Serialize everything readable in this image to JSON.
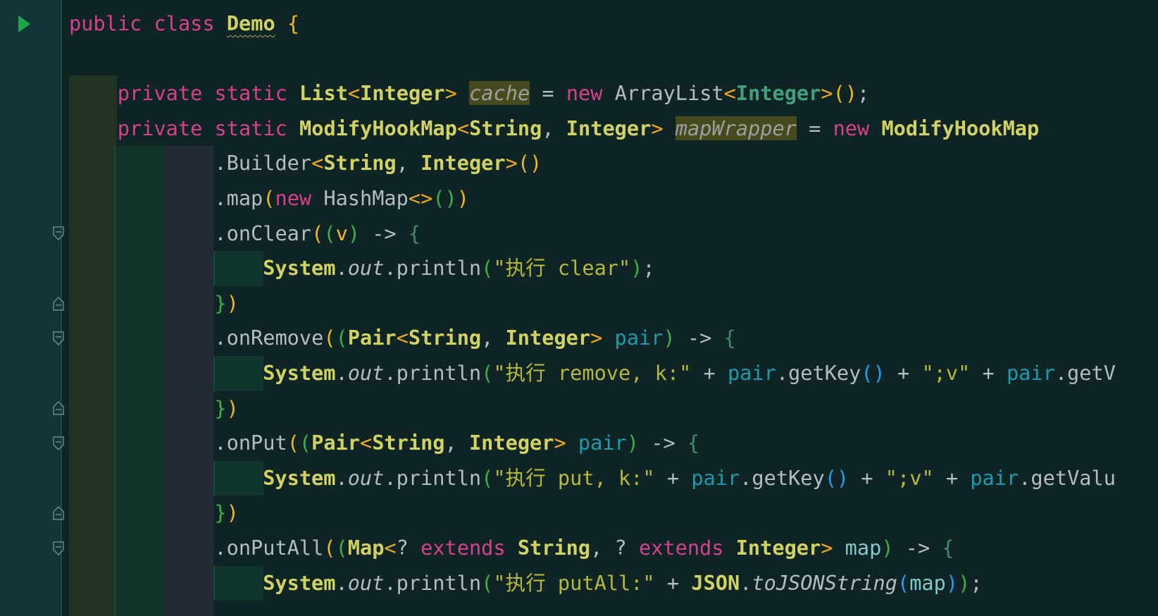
{
  "editor": {
    "language": "java",
    "colors": {
      "keyword": "#d8408d",
      "class": "#d2d262",
      "string": "#b8b83a",
      "parameter": "#1a9cb0",
      "background": "#0f2424",
      "gutter": "#133538",
      "run_icon": "#1fa64a"
    }
  },
  "gutter": {
    "run_icon": "run-class-icon",
    "fold_lines": [
      6,
      8,
      9,
      11,
      12,
      14,
      15
    ]
  },
  "lines": [
    {
      "indent": 0,
      "tokens": [
        [
          "public",
          "kw"
        ],
        [
          " ",
          ""
        ],
        [
          "class",
          "kw"
        ],
        [
          " ",
          ""
        ],
        [
          "Demo",
          "cls und"
        ],
        [
          " ",
          ""
        ],
        [
          "{",
          "br"
        ]
      ]
    },
    {
      "indent": 0,
      "tokens": []
    },
    {
      "indent": 4,
      "tokens": [
        [
          "private",
          "kw"
        ],
        [
          " ",
          ""
        ],
        [
          "static",
          "kw"
        ],
        [
          " ",
          ""
        ],
        [
          "List",
          "cls"
        ],
        [
          "<",
          "ang"
        ],
        [
          "Integer",
          "cls"
        ],
        [
          ">",
          "ang"
        ],
        [
          " ",
          ""
        ],
        [
          "cache",
          "hl"
        ],
        [
          " = ",
          ""
        ],
        [
          "new",
          "kw"
        ],
        [
          " ArrayList",
          ""
        ],
        [
          "<",
          "ang"
        ],
        [
          "Integer",
          "gen"
        ],
        [
          ">",
          "ang"
        ],
        [
          "()",
          "po"
        ],
        [
          ";",
          ""
        ]
      ]
    },
    {
      "indent": 4,
      "tokens": [
        [
          "private",
          "kw"
        ],
        [
          " ",
          ""
        ],
        [
          "static",
          "kw"
        ],
        [
          " ",
          ""
        ],
        [
          "ModifyHookMap",
          "cls"
        ],
        [
          "<",
          "ang"
        ],
        [
          "String",
          "cls"
        ],
        [
          ", ",
          ""
        ],
        [
          "Integer",
          "cls"
        ],
        [
          ">",
          "ang"
        ],
        [
          " ",
          ""
        ],
        [
          "mapWrapper",
          "hl"
        ],
        [
          " = ",
          ""
        ],
        [
          "new",
          "kw"
        ],
        [
          " ",
          ""
        ],
        [
          "ModifyHookMap",
          "cls"
        ]
      ]
    },
    {
      "indent": 12,
      "tokens": [
        [
          ".Builder",
          ""
        ],
        [
          "<",
          "ang"
        ],
        [
          "String",
          "cls"
        ],
        [
          ", ",
          ""
        ],
        [
          "Integer",
          "cls"
        ],
        [
          ">",
          "ang"
        ],
        [
          "()",
          "po"
        ]
      ]
    },
    {
      "indent": 12,
      "tokens": [
        [
          ".map",
          ""
        ],
        [
          "(",
          "po"
        ],
        [
          "new",
          "kw"
        ],
        [
          " HashMap",
          ""
        ],
        [
          "<>",
          "ang"
        ],
        [
          "()",
          "pg"
        ],
        [
          ")",
          "po"
        ]
      ]
    },
    {
      "indent": 12,
      "tokens": [
        [
          ".onClear",
          ""
        ],
        [
          "(",
          "po"
        ],
        [
          "(",
          "pg"
        ],
        [
          "v",
          "v"
        ],
        [
          ")",
          "pg"
        ],
        [
          " -> ",
          ""
        ],
        [
          "{",
          "lb"
        ]
      ]
    },
    {
      "indent": 16,
      "tokens": [
        [
          "System",
          "cls"
        ],
        [
          ".",
          ""
        ],
        [
          "out",
          "it"
        ],
        [
          ".println",
          ""
        ],
        [
          "(",
          "pg"
        ],
        [
          "\"执行 clear\"",
          "str"
        ],
        [
          ")",
          "pg"
        ],
        [
          ";",
          ""
        ]
      ]
    },
    {
      "indent": 12,
      "tokens": [
        [
          "}",
          "pg"
        ],
        [
          ")",
          "po"
        ]
      ]
    },
    {
      "indent": 12,
      "tokens": [
        [
          ".onRemove",
          ""
        ],
        [
          "(",
          "po"
        ],
        [
          "(",
          "pg"
        ],
        [
          "Pair",
          "cls"
        ],
        [
          "<",
          "ang"
        ],
        [
          "String",
          "cls"
        ],
        [
          ", ",
          ""
        ],
        [
          "Integer",
          "cls"
        ],
        [
          ">",
          "ang"
        ],
        [
          " ",
          ""
        ],
        [
          "pair",
          "pair"
        ],
        [
          ")",
          "pg"
        ],
        [
          " -> ",
          ""
        ],
        [
          "{",
          "lb"
        ]
      ]
    },
    {
      "indent": 16,
      "tokens": [
        [
          "System",
          "cls"
        ],
        [
          ".",
          ""
        ],
        [
          "out",
          "it"
        ],
        [
          ".println",
          ""
        ],
        [
          "(",
          "pg"
        ],
        [
          "\"执行 remove, k:\"",
          "str"
        ],
        [
          " + ",
          ""
        ],
        [
          "pair",
          "pair"
        ],
        [
          ".getKey",
          ""
        ],
        [
          "()",
          "pb"
        ],
        [
          " + ",
          ""
        ],
        [
          "\";v\"",
          "str"
        ],
        [
          " + ",
          ""
        ],
        [
          "pair",
          "pair"
        ],
        [
          ".getV",
          ""
        ]
      ]
    },
    {
      "indent": 12,
      "tokens": [
        [
          "}",
          "pg"
        ],
        [
          ")",
          "po"
        ]
      ]
    },
    {
      "indent": 12,
      "tokens": [
        [
          ".onPut",
          ""
        ],
        [
          "(",
          "po"
        ],
        [
          "(",
          "pg"
        ],
        [
          "Pair",
          "cls"
        ],
        [
          "<",
          "ang"
        ],
        [
          "String",
          "cls"
        ],
        [
          ", ",
          ""
        ],
        [
          "Integer",
          "cls"
        ],
        [
          ">",
          "ang"
        ],
        [
          " ",
          ""
        ],
        [
          "pair",
          "pair"
        ],
        [
          ")",
          "pg"
        ],
        [
          " -> ",
          ""
        ],
        [
          "{",
          "lb"
        ]
      ]
    },
    {
      "indent": 16,
      "tokens": [
        [
          "System",
          "cls"
        ],
        [
          ".",
          ""
        ],
        [
          "out",
          "it"
        ],
        [
          ".println",
          ""
        ],
        [
          "(",
          "pg"
        ],
        [
          "\"执行 put, k:\"",
          "str"
        ],
        [
          " + ",
          ""
        ],
        [
          "pair",
          "pair"
        ],
        [
          ".getKey",
          ""
        ],
        [
          "()",
          "pb"
        ],
        [
          " + ",
          ""
        ],
        [
          "\";v\"",
          "str"
        ],
        [
          " + ",
          ""
        ],
        [
          "pair",
          "pair"
        ],
        [
          ".getValu",
          ""
        ]
      ]
    },
    {
      "indent": 12,
      "tokens": [
        [
          "}",
          "pg"
        ],
        [
          ")",
          "po"
        ]
      ]
    },
    {
      "indent": 12,
      "tokens": [
        [
          ".onPutAll",
          ""
        ],
        [
          "(",
          "po"
        ],
        [
          "(",
          "pg"
        ],
        [
          "Map",
          "cls"
        ],
        [
          "<",
          "ang"
        ],
        [
          "? ",
          ""
        ],
        [
          "extends",
          "kw"
        ],
        [
          " ",
          ""
        ],
        [
          "String",
          "cls"
        ],
        [
          ", ? ",
          ""
        ],
        [
          "extends",
          "kw"
        ],
        [
          " ",
          ""
        ],
        [
          "Integer",
          "cls"
        ],
        [
          ">",
          "ang"
        ],
        [
          " ",
          ""
        ],
        [
          "map",
          "mp"
        ],
        [
          ")",
          "pg"
        ],
        [
          " -> ",
          ""
        ],
        [
          "{",
          "lb"
        ]
      ]
    },
    {
      "indent": 16,
      "tokens": [
        [
          "System",
          "cls"
        ],
        [
          ".",
          ""
        ],
        [
          "out",
          "it"
        ],
        [
          ".println",
          ""
        ],
        [
          "(",
          "pg"
        ],
        [
          "\"执行 putAll:\"",
          "str"
        ],
        [
          " + ",
          ""
        ],
        [
          "JSON",
          "cls"
        ],
        [
          ".",
          ""
        ],
        [
          "toJSONString",
          "it"
        ],
        [
          "(",
          "pb"
        ],
        [
          "map",
          "mp"
        ],
        [
          ")",
          "pb"
        ],
        [
          ")",
          "pg"
        ],
        [
          ";",
          ""
        ]
      ]
    }
  ]
}
